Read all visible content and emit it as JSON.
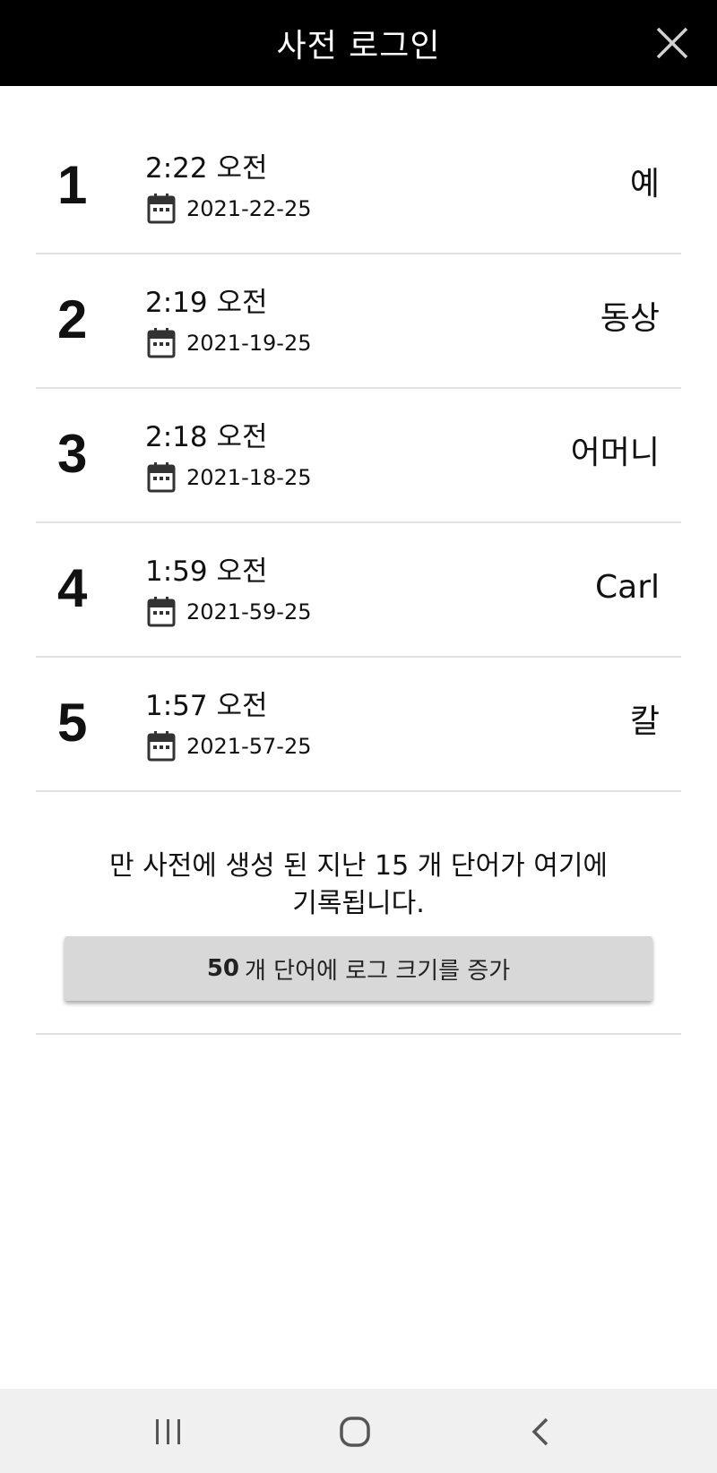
{
  "header": {
    "title": "사전 로그인",
    "close_icon": "close-icon"
  },
  "entries": [
    {
      "number": "1",
      "time": "2:22 오전",
      "date": "2021-22-25",
      "word": "예"
    },
    {
      "number": "2",
      "time": "2:19 오전",
      "date": "2021-19-25",
      "word": "동상"
    },
    {
      "number": "3",
      "time": "2:18 오전",
      "date": "2021-18-25",
      "word": "어머니"
    },
    {
      "number": "4",
      "time": "1:59 오전",
      "date": "2021-59-25",
      "word": "Carl"
    },
    {
      "number": "5",
      "time": "1:57 오전",
      "date": "2021-57-25",
      "word": "칼"
    }
  ],
  "info": {
    "line1": "만 사전에 생성 된 지난 15 개 단어가 여기에",
    "line2": "기록됩니다."
  },
  "cta": {
    "number": "50",
    "label": "개 단어에 로그 크기를 증가"
  },
  "nav": {
    "recents_icon": "recent-apps-icon",
    "home_icon": "home-icon",
    "back_icon": "back-icon"
  },
  "colors": {
    "header_bg": "#000000",
    "button_bg": "#d8d8d8",
    "divider": "#e1e1e1",
    "navbar_bg": "#f0f0f0"
  }
}
